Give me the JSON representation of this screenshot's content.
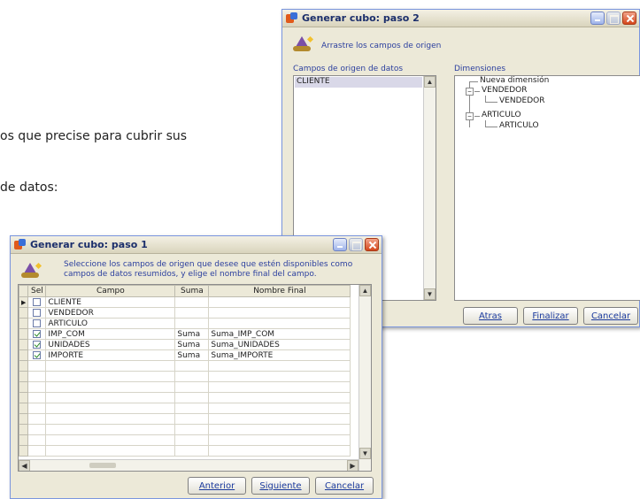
{
  "doc": {
    "line1": "os que precise para cubrir sus",
    "line2": "de datos:"
  },
  "win2": {
    "title": "Generar cubo: paso 2",
    "hint": "Arrastre los campos de origen",
    "source_label": "Campos de origen de datos",
    "dims_label": "Dimensiones",
    "source_items": [
      "CLIENTE"
    ],
    "tree": {
      "root": "Nueva dimensión",
      "nodes": [
        {
          "label": "VENDEDOR",
          "child": "VENDEDOR"
        },
        {
          "label": "ARTICULO",
          "child": "ARTICULO"
        }
      ]
    },
    "buttons": {
      "back": "Atras",
      "finish": "Finalizar",
      "cancel": "Cancelar"
    }
  },
  "win1": {
    "title": "Generar cubo: paso 1",
    "hint_line1": "Seleccione los campos de origen que desee que estén disponibles como",
    "hint_line2": "campos de datos resumidos, y elige el nombre final del campo.",
    "columns": {
      "sel": "Sel",
      "campo": "Campo",
      "suma": "Suma",
      "nombre": "Nombre Final"
    },
    "rows": [
      {
        "checked": false,
        "campo": "CLIENTE",
        "suma": "",
        "nombre": ""
      },
      {
        "checked": false,
        "campo": "VENDEDOR",
        "suma": "",
        "nombre": ""
      },
      {
        "checked": false,
        "campo": "ARTICULO",
        "suma": "",
        "nombre": ""
      },
      {
        "checked": true,
        "campo": "IMP_COM",
        "suma": "Suma",
        "nombre": "Suma_IMP_COM"
      },
      {
        "checked": true,
        "campo": "UNIDADES",
        "suma": "Suma",
        "nombre": "Suma_UNIDADES"
      },
      {
        "checked": true,
        "campo": "IMPORTE",
        "suma": "Suma",
        "nombre": "Suma_IMPORTE"
      }
    ],
    "empty_rows": 9,
    "buttons": {
      "prev": "Anterior",
      "next": "Siguiente",
      "cancel": "Cancelar"
    }
  },
  "colors": {
    "title_text": "#1b2e6b",
    "hint_text": "#2b3f9e",
    "window_bg": "#ece9d8"
  }
}
